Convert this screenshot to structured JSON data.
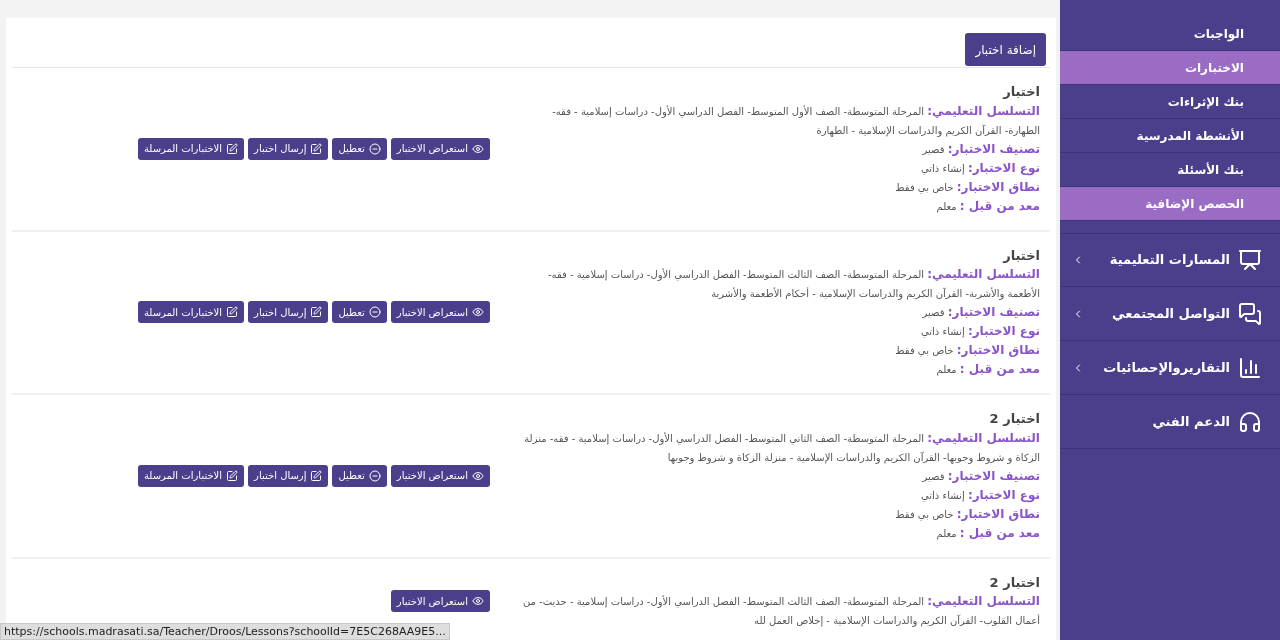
{
  "add_button": "إضافة اختبار",
  "tests": [
    {
      "title": "اختبار",
      "fields": [
        {
          "label": "التسلسل التعليمي:",
          "value": "المرحلة المتوسطة- الصف الأول المتوسط- الفصل الدراسي الأول- دراسات إسلامية - فقه- الطهارة- القرآن الكريم والدراسات الإسلامية - الطهارة"
        },
        {
          "label": "تصنيف الاختبار:",
          "value": "قصير"
        },
        {
          "label": "نوع الاختبار:",
          "value": "إنشاء ذاتي"
        },
        {
          "label": "نطاق الاختبار:",
          "value": "خاص بي فقط"
        },
        {
          "label": "معد من قبل :",
          "value": "معلم"
        }
      ],
      "buttons": [
        {
          "kind": "view",
          "label": "استعراض الاختبار"
        },
        {
          "kind": "disable",
          "label": "تعطيل"
        },
        {
          "kind": "send",
          "label": "إرسال اختبار"
        },
        {
          "kind": "sent",
          "label": "الاختبارات المرسلة"
        }
      ]
    },
    {
      "title": "اختبار",
      "fields": [
        {
          "label": "التسلسل التعليمي:",
          "value": "المرحلة المتوسطة- الصف الثالث المتوسط- الفصل الدراسي الأول- دراسات إسلامية - فقه- الأطعمة والأشربة- القرآن الكريم والدراسات الإسلامية - أحكام الأطعمة والأشربة"
        },
        {
          "label": "تصنيف الاختبار:",
          "value": "قصير"
        },
        {
          "label": "نوع الاختبار:",
          "value": "إنشاء ذاتي"
        },
        {
          "label": "نطاق الاختبار:",
          "value": "خاص بي فقط"
        },
        {
          "label": "معد من قبل :",
          "value": "معلم"
        }
      ],
      "buttons": [
        {
          "kind": "view",
          "label": "استعراض الاختبار"
        },
        {
          "kind": "disable",
          "label": "تعطيل"
        },
        {
          "kind": "send",
          "label": "إرسال اختبار"
        },
        {
          "kind": "sent",
          "label": "الاختبارات المرسلة"
        }
      ]
    },
    {
      "title": "اختبار 2",
      "fields": [
        {
          "label": "التسلسل التعليمي:",
          "value": "المرحلة المتوسطة- الصف الثاني المتوسط- الفصل الدراسي الأول- دراسات إسلامية - فقه- منزلة الزكاة و شروط وجوبها- القرآن الكريم والدراسات الإسلامية - منزلة الزكاة و شروط وجوبها"
        },
        {
          "label": "تصنيف الاختبار:",
          "value": "قصير"
        },
        {
          "label": "نوع الاختبار:",
          "value": "إنشاء ذاتي"
        },
        {
          "label": "نطاق الاختبار:",
          "value": "خاص بي فقط"
        },
        {
          "label": "معد من قبل :",
          "value": "معلم"
        }
      ],
      "buttons": [
        {
          "kind": "view",
          "label": "استعراض الاختبار"
        },
        {
          "kind": "disable",
          "label": "تعطيل"
        },
        {
          "kind": "send",
          "label": "إرسال اختبار"
        },
        {
          "kind": "sent",
          "label": "الاختبارات المرسلة"
        }
      ]
    },
    {
      "title": "اختبار 2",
      "fields": [
        {
          "label": "التسلسل التعليمي:",
          "value": "المرحلة المتوسطة- الصف الثالث المتوسط- الفصل الدراسي الأول- دراسات إسلامية - حديث- من أعمال القلوب- القرآن الكريم والدراسات الإسلامية - إخلاص العمل لله"
        }
      ],
      "buttons": [
        {
          "kind": "view",
          "label": "استعراض الاختبار"
        }
      ]
    }
  ],
  "sidebar": {
    "items": [
      {
        "kind": "sub",
        "label": "الواجبات",
        "selected": false
      },
      {
        "kind": "sub",
        "label": "الاختبارات",
        "selected": true
      },
      {
        "kind": "sub",
        "label": "بنك الإثراءات",
        "selected": false
      },
      {
        "kind": "sub",
        "label": "الأنشطة المدرسية",
        "selected": false
      },
      {
        "kind": "sub",
        "label": "بنك الأسئلة",
        "selected": false
      },
      {
        "kind": "sub",
        "label": "الحصص الإضافية",
        "selected": true
      },
      {
        "kind": "section",
        "label": "المسارات التعليمية",
        "expandable": true
      },
      {
        "kind": "section",
        "label": "التواصل المجتمعي",
        "expandable": true
      },
      {
        "kind": "section",
        "label": "التقاريروالإحصائيات",
        "expandable": true
      },
      {
        "kind": "section",
        "label": "الدعم الفني",
        "expandable": false
      }
    ]
  },
  "status_bar": {
    "url": "https://schools.madrasati.sa/Teacher/Droos/Lessons?schoolId=7E5C268AA9E5..."
  }
}
